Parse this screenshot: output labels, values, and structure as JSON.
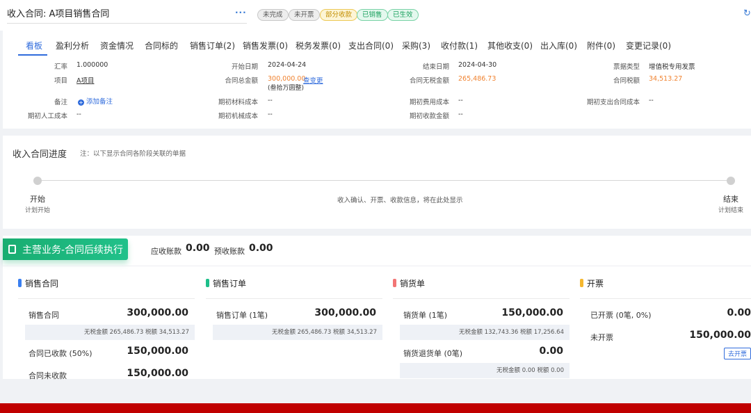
{
  "header": {
    "title": "收入合同: A项目销售合同",
    "more": "···",
    "tags": [
      {
        "label": "未完成",
        "style": "gray"
      },
      {
        "label": "未开票",
        "style": "gray"
      },
      {
        "label": "部分收款",
        "style": "yellow"
      },
      {
        "label": "已销售",
        "style": "green"
      },
      {
        "label": "已生效",
        "style": "green"
      }
    ],
    "refresh_icon": "refresh-icon"
  },
  "tabs": [
    {
      "label": "看板",
      "active": true
    },
    {
      "label": "盈利分析"
    },
    {
      "label": "资金情况"
    },
    {
      "label": "合同标的"
    },
    {
      "label": "销售订单(2)"
    },
    {
      "label": "销售发票(0)"
    },
    {
      "label": "税务发票(0)"
    },
    {
      "label": "支出合同(0)"
    },
    {
      "label": "采购(3)"
    },
    {
      "label": "收付款(1)"
    },
    {
      "label": "其他收支(0)"
    },
    {
      "label": "出入库(0)"
    },
    {
      "label": "附件(0)"
    },
    {
      "label": "变更记录(0)"
    }
  ],
  "info": {
    "exchange_rate_label": "汇率",
    "exchange_rate": "1.000000",
    "start_date_label": "开始日期",
    "start_date": "2024-04-24",
    "end_date_label": "结束日期",
    "end_date": "2024-04-30",
    "invoice_type_label": "票据类型",
    "invoice_type": "增值税专用发票",
    "project_label": "项目",
    "project": "A项目",
    "total_amount_label": "合同总金额",
    "total_amount": "300,000.00",
    "view_change": "查变更",
    "total_amount_cn": "(叁拾万圆整)",
    "untaxed_label": "合同无税金额",
    "untaxed": "265,486.73",
    "tax_label": "合同税额",
    "tax": "34,513.27",
    "remark_label": "备注",
    "add_remark": "添加备注",
    "init_material_label": "期初材料成本",
    "init_material": "--",
    "init_expense_label": "期初费用成本",
    "init_expense": "--",
    "init_outlay_label": "期初支出合同成本",
    "init_outlay": "--",
    "init_labor_label": "期初人工成本",
    "init_labor": "--",
    "init_machine_label": "期初机械成本",
    "init_machine": "--",
    "init_received_label": "期初收款金额",
    "init_received": "--"
  },
  "progress": {
    "title": "收入合同进度",
    "note": "注：以下显示合同各阶段关联的单据",
    "start_label": "开始",
    "start_sub": "计划开始",
    "middle": "收入确认、开票、收款信息，将在此处显示",
    "end_label": "结束",
    "end_sub": "计划结束"
  },
  "business": {
    "banner": "主营业务-合同后续执行",
    "receivable_label": "应收账款",
    "receivable": "0.00",
    "prepaid_label": "预收账款",
    "prepaid": "0.00",
    "sales_contract": {
      "title": "销售合同",
      "color": "#3a7ff0",
      "row1_label": "销售合同",
      "row1_value": "300,000.00",
      "row1_sub": "无税金额 265,486.73 税额 34,513.27",
      "row2_label": "合同已收款 (50%)",
      "row2_value": "150,000.00",
      "row3_label": "合同未收款",
      "row3_value": "150,000.00"
    },
    "sales_order": {
      "title": "销售订单",
      "color": "#1dbf8a",
      "row1_label": "销售订单 (1笔)",
      "row1_value": "300,000.00",
      "row1_sub": "无税金额 265,486.73 税额 34,513.27"
    },
    "delivery": {
      "title": "销货单",
      "color": "#f27575",
      "row1_label": "销货单 (1笔)",
      "row1_value": "150,000.00",
      "row1_sub": "无税金额 132,743.36 税额 17,256.64",
      "row2_label": "销货退货单 (0笔)",
      "row2_value": "0.00",
      "row2_sub": "无税金额 0.00 税额 0.00"
    },
    "invoice": {
      "title": "开票",
      "color": "#f5b72e",
      "row1_label": "已开票 (0笔, 0%)",
      "row1_value": "0.00",
      "row2_label": "未开票",
      "row2_value": "150,000.00",
      "button": "去开票"
    }
  }
}
